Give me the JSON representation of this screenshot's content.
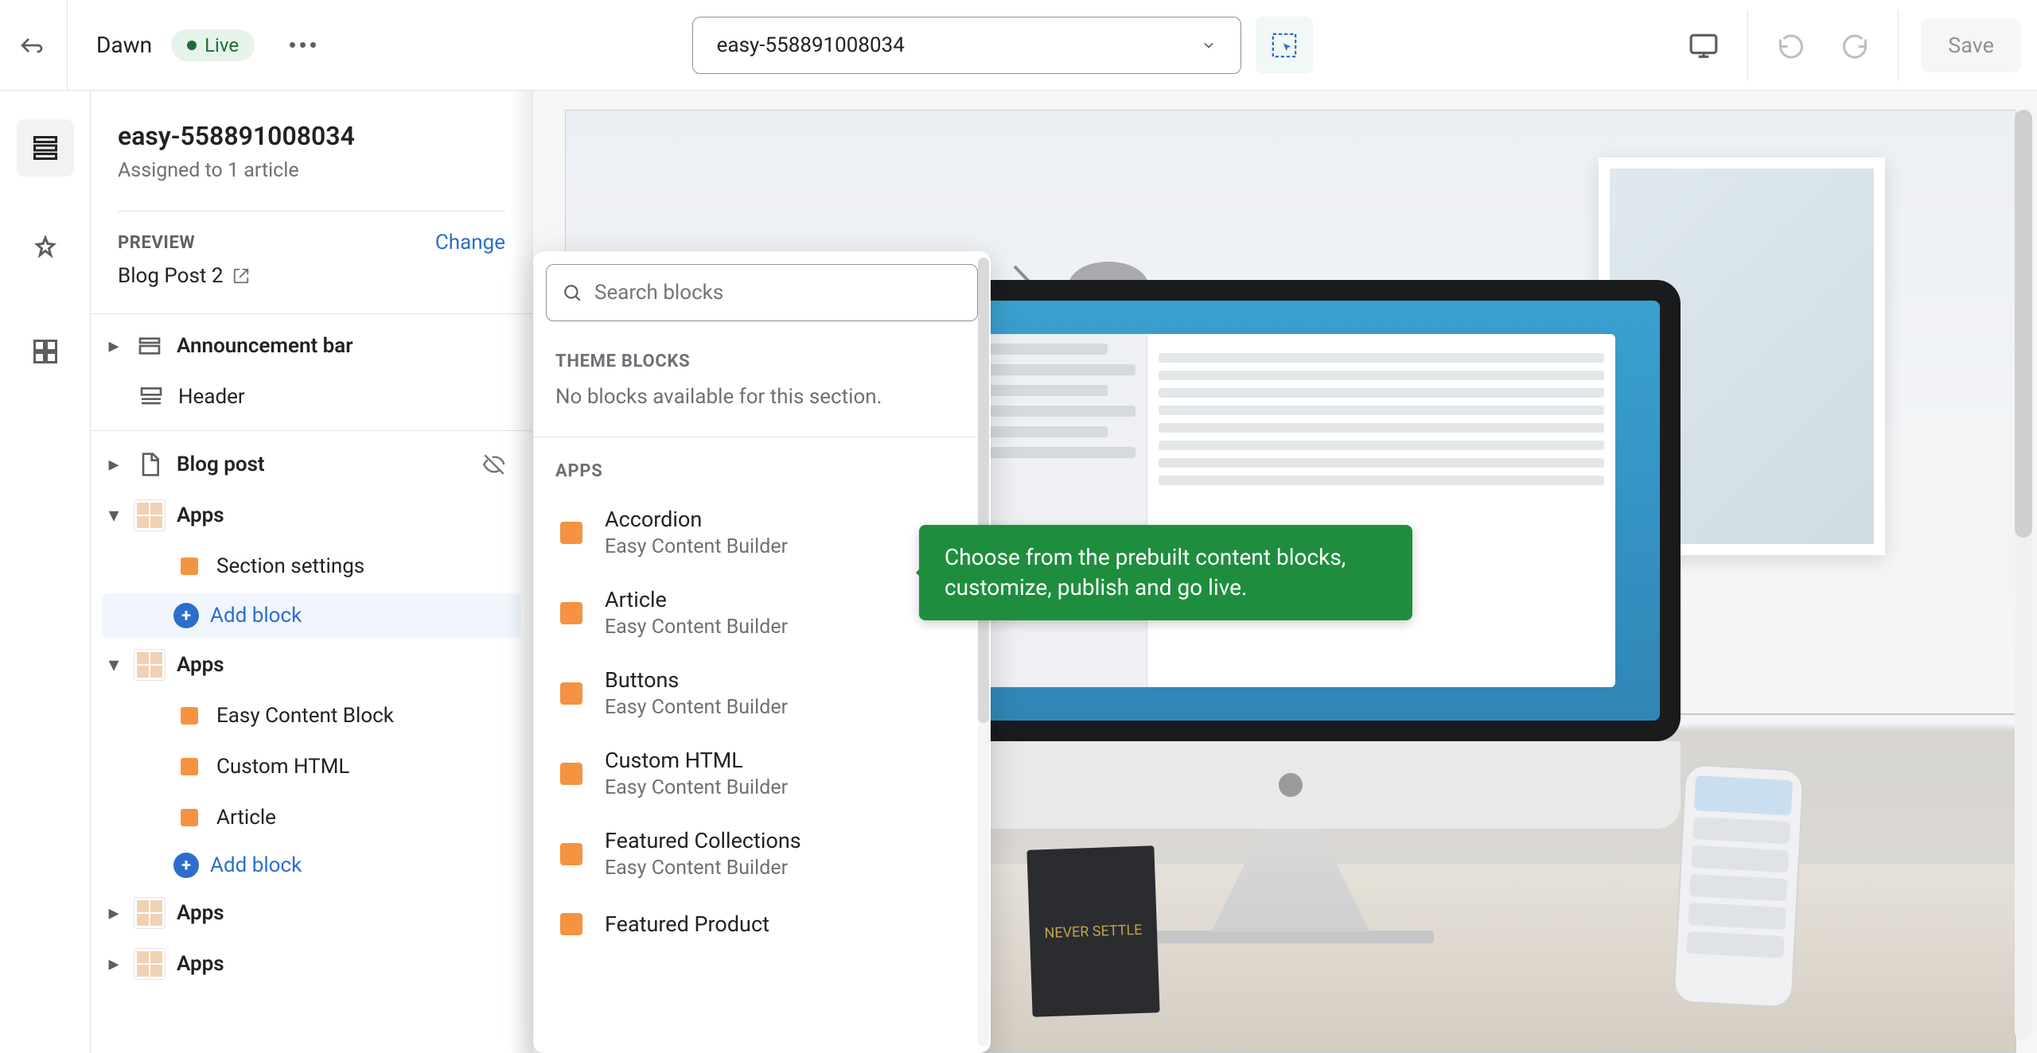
{
  "topbar": {
    "theme_name": "Dawn",
    "live_label": "Live",
    "page_selector": "easy-558891008034",
    "save_label": "Save"
  },
  "sidebar": {
    "template_title": "easy-558891008034",
    "template_subtitle": "Assigned to 1 article",
    "preview_label": "Preview",
    "change_label": "Change",
    "preview_link_text": "Blog Post 2",
    "tree": {
      "announcement_bar": "Announcement bar",
      "header": "Header",
      "blog_post": "Blog post",
      "apps": "Apps",
      "section_settings": "Section settings",
      "add_block": "Add block",
      "easy_content_block": "Easy Content Block",
      "custom_html": "Custom HTML",
      "article": "Article"
    }
  },
  "popover": {
    "search_placeholder": "Search blocks",
    "theme_blocks_label": "Theme blocks",
    "theme_blocks_empty": "No blocks available for this section.",
    "apps_label": "Apps",
    "builder_sub": "Easy Content Builder",
    "blocks": {
      "accordion": "Accordion",
      "article": "Article",
      "buttons": "Buttons",
      "custom_html": "Custom HTML",
      "featured_collections": "Featured Collections",
      "featured_product": "Featured Product"
    }
  },
  "tooltip": {
    "text": "Choose from the prebuilt content blocks, customize, publish and go live."
  },
  "preview": {
    "notebook_text": "NEVER SETTLE"
  }
}
